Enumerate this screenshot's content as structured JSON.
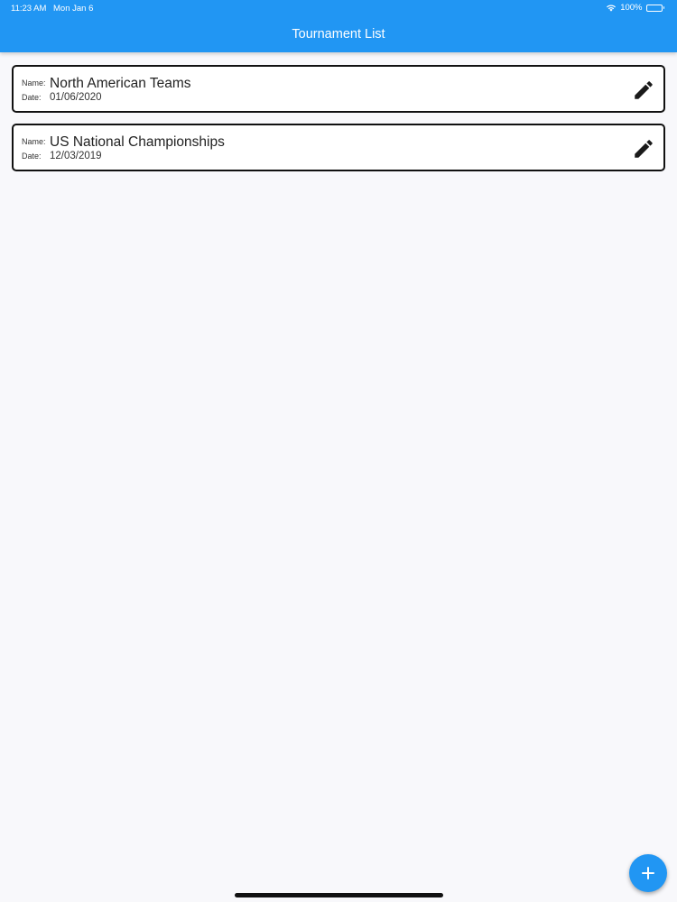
{
  "status_bar": {
    "time": "11:23 AM",
    "date": "Mon Jan 6",
    "battery": "100%",
    "icons": [
      "wifi-icon",
      "battery-icon"
    ]
  },
  "header": {
    "title": "Tournament List"
  },
  "tournaments": [
    {
      "name_label": "Name:",
      "name": "North American Teams",
      "date_label": "Date:",
      "date": "01/06/2020",
      "action_icon": "pencil-icon"
    },
    {
      "name_label": "Name:",
      "name": "US National Championships",
      "date_label": "Date:",
      "date": "12/03/2019",
      "action_icon": "pencil-icon"
    }
  ],
  "fab": {
    "icon": "plus-icon"
  },
  "colors": {
    "primary": "#2196f3",
    "background": "#f8f8fb",
    "card_border": "#111111",
    "text": "#222222"
  }
}
